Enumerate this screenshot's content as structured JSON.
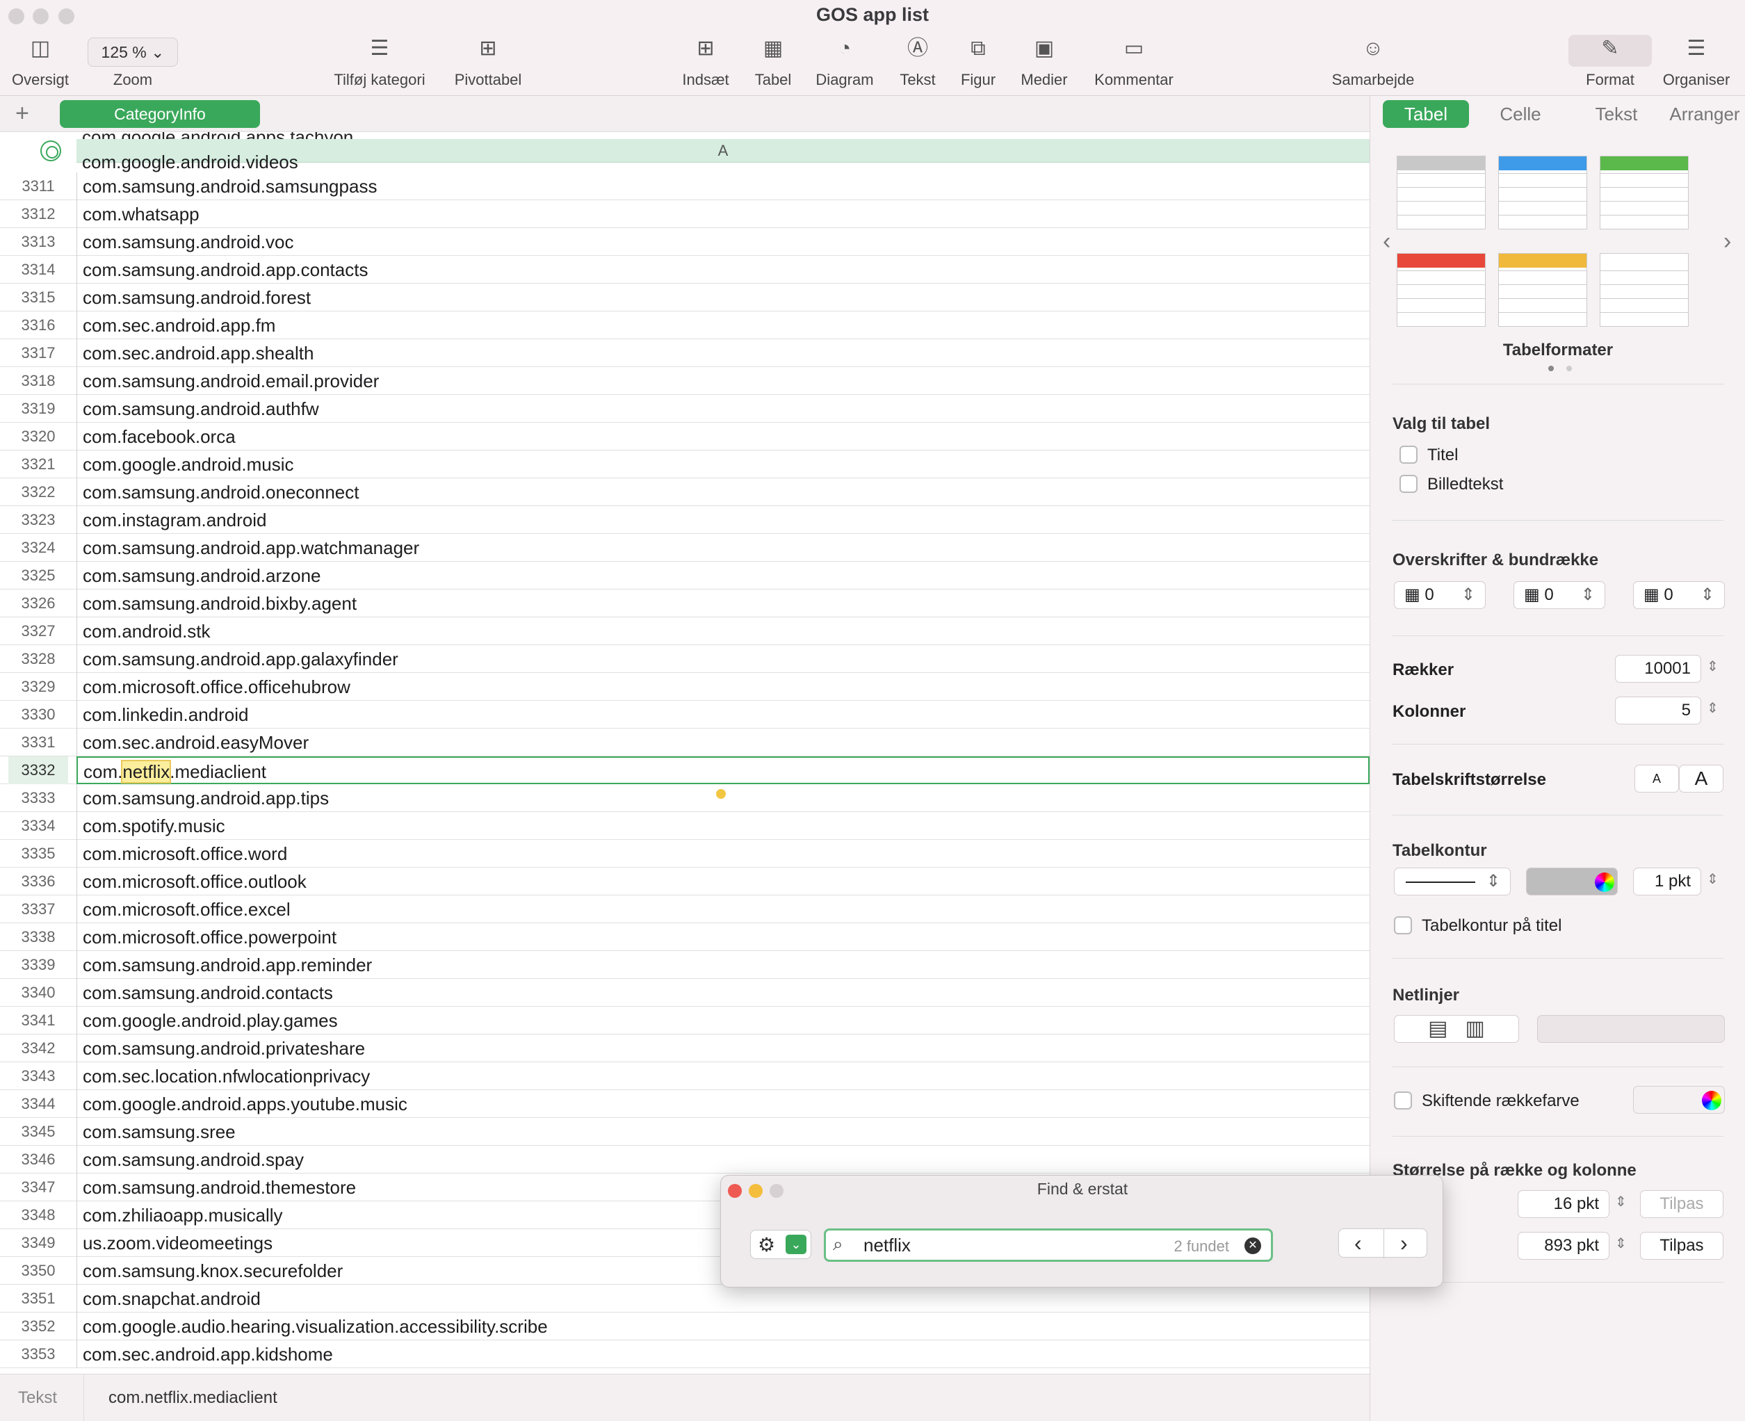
{
  "window": {
    "title": "GOS app list"
  },
  "toolbar": {
    "oversigt": "Oversigt",
    "zoom_value": "125 %",
    "zoom": "Zoom",
    "tilfoj_kategori": "Tilføj kategori",
    "pivottabel": "Pivottabel",
    "indsaet": "Indsæt",
    "tabel": "Tabel",
    "diagram": "Diagram",
    "tekst": "Tekst",
    "figur": "Figur",
    "medier": "Medier",
    "kommentar": "Kommentar",
    "samarbejde": "Samarbejde",
    "format": "Format",
    "organiser": "Organiser"
  },
  "sheet": {
    "add": "+",
    "tab_name": "CategoryInfo",
    "column_header": "A",
    "partial_row_text": "com.google.android.apps.tachyon",
    "partial_row_text2": "com.google.android.videos"
  },
  "rows": [
    {
      "n": "3311",
      "v": "com.samsung.android.samsungpass"
    },
    {
      "n": "3312",
      "v": "com.whatsapp"
    },
    {
      "n": "3313",
      "v": "com.samsung.android.voc"
    },
    {
      "n": "3314",
      "v": "com.samsung.android.app.contacts"
    },
    {
      "n": "3315",
      "v": "com.samsung.android.forest"
    },
    {
      "n": "3316",
      "v": "com.sec.android.app.fm"
    },
    {
      "n": "3317",
      "v": "com.sec.android.app.shealth"
    },
    {
      "n": "3318",
      "v": "com.samsung.android.email.provider"
    },
    {
      "n": "3319",
      "v": "com.samsung.android.authfw"
    },
    {
      "n": "3320",
      "v": "com.facebook.orca"
    },
    {
      "n": "3321",
      "v": "com.google.android.music"
    },
    {
      "n": "3322",
      "v": "com.samsung.android.oneconnect"
    },
    {
      "n": "3323",
      "v": "com.instagram.android"
    },
    {
      "n": "3324",
      "v": "com.samsung.android.app.watchmanager"
    },
    {
      "n": "3325",
      "v": "com.samsung.android.arzone"
    },
    {
      "n": "3326",
      "v": "com.samsung.android.bixby.agent"
    },
    {
      "n": "3327",
      "v": "com.android.stk"
    },
    {
      "n": "3328",
      "v": "com.samsung.android.app.galaxyfinder"
    },
    {
      "n": "3329",
      "v": "com.microsoft.office.officehubrow"
    },
    {
      "n": "3330",
      "v": "com.linkedin.android"
    },
    {
      "n": "3331",
      "v": "com.sec.android.easyMover"
    },
    {
      "n": "3332",
      "v": "com.netflix.mediaclient",
      "pre": "com.",
      "match": "netflix",
      "post": ".mediaclient",
      "selected": true
    },
    {
      "n": "3333",
      "v": "com.samsung.android.app.tips"
    },
    {
      "n": "3334",
      "v": "com.spotify.music"
    },
    {
      "n": "3335",
      "v": "com.microsoft.office.word"
    },
    {
      "n": "3336",
      "v": "com.microsoft.office.outlook"
    },
    {
      "n": "3337",
      "v": "com.microsoft.office.excel"
    },
    {
      "n": "3338",
      "v": "com.microsoft.office.powerpoint"
    },
    {
      "n": "3339",
      "v": "com.samsung.android.app.reminder"
    },
    {
      "n": "3340",
      "v": "com.samsung.android.contacts"
    },
    {
      "n": "3341",
      "v": "com.google.android.play.games"
    },
    {
      "n": "3342",
      "v": "com.samsung.android.privateshare"
    },
    {
      "n": "3343",
      "v": "com.sec.location.nfwlocationprivacy"
    },
    {
      "n": "3344",
      "v": "com.google.android.apps.youtube.music"
    },
    {
      "n": "3345",
      "v": "com.samsung.sree"
    },
    {
      "n": "3346",
      "v": "com.samsung.android.spay"
    },
    {
      "n": "3347",
      "v": "com.samsung.android.themestore"
    },
    {
      "n": "3348",
      "v": "com.zhiliaoapp.musically"
    },
    {
      "n": "3349",
      "v": "us.zoom.videomeetings"
    },
    {
      "n": "3350",
      "v": "com.samsung.knox.securefolder"
    },
    {
      "n": "3351",
      "v": "com.snapchat.android"
    },
    {
      "n": "3352",
      "v": "com.google.audio.hearing.visualization.accessibility.scribe"
    },
    {
      "n": "3353",
      "v": "com.sec.android.app.kidshome"
    }
  ],
  "inspector": {
    "tabs": [
      "Tabel",
      "Celle",
      "Tekst",
      "Arranger"
    ],
    "table_styles_label": "Tabelformater",
    "table_style_colors": [
      "#c8c8c8",
      "#3d9be9",
      "#5bb84a",
      "#e8483a",
      "#f0b93c",
      "#ffffff"
    ],
    "valg_til_tabel": "Valg til tabel",
    "titel": "Titel",
    "billedtekst": "Billedtekst",
    "overskrifter": "Overskrifter & bundrække",
    "header_rows": "0",
    "header_cols": "0",
    "footer_rows": "0",
    "raekker_label": "Rækker",
    "raekker": "10001",
    "kolonner_label": "Kolonner",
    "kolonner": "5",
    "font_size_label": "Tabelskriftstørrelse",
    "font_small": "A",
    "font_large": "A",
    "kontur_label": "Tabelkontur",
    "kontur_width": "1 pkt",
    "kontur_titel": "Tabelkontur på titel",
    "netlinjer": "Netlinjer",
    "skiftende": "Skiftende rækkefarve",
    "storrelse": "Størrelse på række og kolonne",
    "row_height": "16 pkt",
    "col_width": "893 pkt",
    "col_suffix": "e",
    "tilpas1": "Tilpas",
    "tilpas2": "Tilpas"
  },
  "find": {
    "title": "Find & erstat",
    "query": "netflix",
    "count": "2 fundet"
  },
  "status": {
    "label": "Tekst",
    "value": "com.netflix.mediaclient"
  },
  "colors": {
    "accent": "#3aa85b",
    "highlight": "#fbee9c"
  }
}
